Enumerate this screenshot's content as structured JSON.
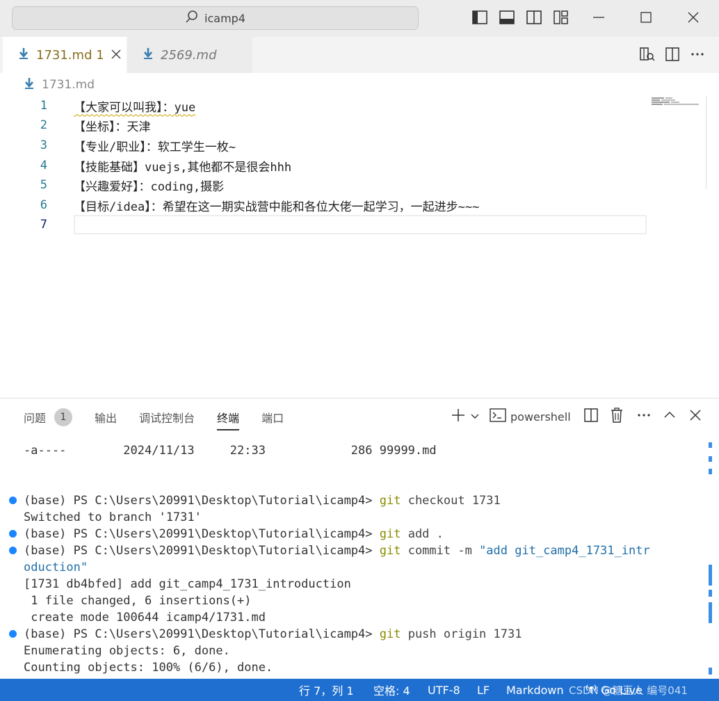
{
  "window": {
    "search_text": "icamp4"
  },
  "tabs": [
    {
      "label": "1731.md",
      "badge": "1"
    },
    {
      "label": "2569.md"
    }
  ],
  "breadcrumb": {
    "file": "1731.md"
  },
  "editor": {
    "lines": [
      {
        "num": "1",
        "text": "【大家可以叫我】：yue"
      },
      {
        "num": "2",
        "text": "【坐标】：天津"
      },
      {
        "num": "3",
        "text": "【专业/职业】：软工学生一枚~"
      },
      {
        "num": "4",
        "text": "【技能基础】vuejs,其他都不是很会hhh"
      },
      {
        "num": "5",
        "text": "【兴趣爱好】：coding,摄影"
      },
      {
        "num": "6",
        "text": "【目标/idea】：希望在这一期实战营中能和各位大佬一起学习，一起进步~~~"
      },
      {
        "num": "7",
        "text": ""
      }
    ]
  },
  "panel": {
    "tabs": [
      "问题",
      "输出",
      "调试控制台",
      "终端",
      "端口"
    ],
    "problems_count": "1",
    "shell_label": "powershell"
  },
  "terminal": {
    "l1": "-a----        2024/11/13     22:33            286 99999.md",
    "prompt": "(base) PS C:\\Users\\20991\\Desktop\\Tutorial\\icamp4> ",
    "git": "git",
    "c1_args": " checkout 1731",
    "l2": "Switched to branch '1731'",
    "c2_args": " add .",
    "c3_args": " commit -m ",
    "c3_str_a": "\"add git_camp4_1731_intr",
    "c3_str_b": "oduction\"",
    "l3": "[1731 db4bfed] add git_camp4_1731_introduction",
    "l4": " 1 file changed, 6 insertions(+)",
    "l5": " create mode 100644 icamp4/1731.md",
    "c4_args": " push origin 1731",
    "l6": "Enumerating objects: 6, done.",
    "l7": "Counting objects: 100% (6/6), done."
  },
  "statusbar": {
    "position": "行 7，列 1",
    "spaces": "空格: 4",
    "encoding": "UTF-8",
    "eol": "LF",
    "language": "Markdown",
    "live": "Go Live",
    "watermark": "CSDN @糖豆人 编号041"
  }
}
